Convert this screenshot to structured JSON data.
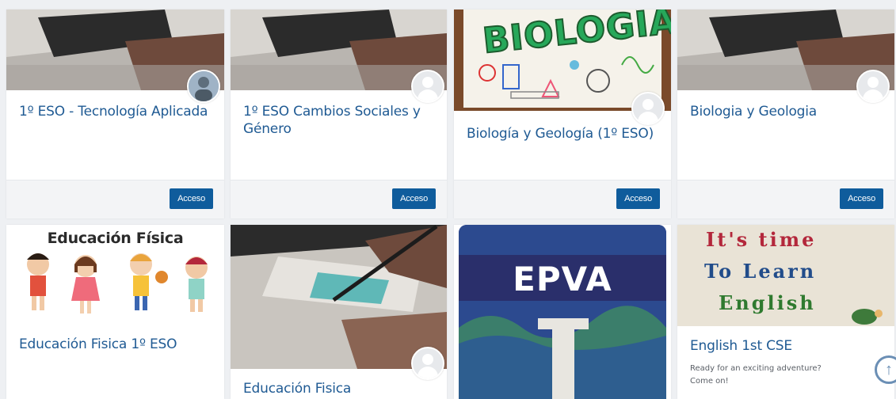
{
  "courses_row1": [
    {
      "title": "1º ESO - Tecnología Aplicada",
      "button": "Acceso"
    },
    {
      "title": "1º ESO Cambios Sociales y Género",
      "button": "Acceso"
    },
    {
      "title": "Biología y Geología (1º ESO)",
      "button": "Acceso",
      "image_text": "BIOLOGÍA"
    },
    {
      "title": "Biologia y Geologia",
      "button": "Acceso"
    }
  ],
  "courses_row2": [
    {
      "title": "Educación Fisica 1º ESO",
      "image_text": "Educación Física"
    },
    {
      "title": "Educación Fisica"
    },
    {
      "title": "",
      "image_text": "EPVA"
    },
    {
      "title": "English 1st CSE",
      "image_text": [
        "It's time",
        "To Learn",
        "English"
      ],
      "description": [
        "Ready for an exciting adventure?",
        "Come on!"
      ]
    }
  ],
  "colors": {
    "accent": "#0f5c9c",
    "title": "#1f5a93",
    "background": "#eef0f3"
  },
  "icons": {
    "scroll_top": "arrow-up-circle-icon",
    "avatar": "user-avatar-icon"
  }
}
